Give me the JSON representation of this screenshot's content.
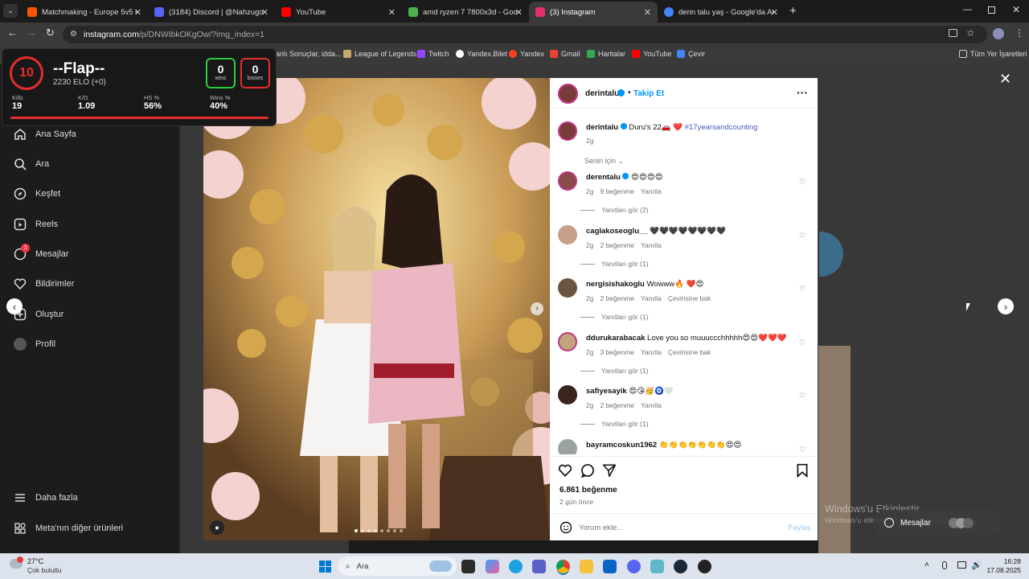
{
  "browser": {
    "tabs": [
      {
        "label": "Matchmaking - Europe 5v5 Qu",
        "color": "#ff5500"
      },
      {
        "label": "(3184) Discord | @Nahzugo",
        "color": "#5865f2"
      },
      {
        "label": "YouTube",
        "color": "#ff0000"
      },
      {
        "label": "amd ryzen 7 7800x3d - Google",
        "color": "#4caf50"
      },
      {
        "label": "(3) Instagram",
        "color": "#e1306c"
      },
      {
        "label": "derin talu yaş - Google'da Ara",
        "color": "#4285f4"
      }
    ],
    "url_host": "instagram.com",
    "url_path": "/p/DNWIbkOKgOw/?img_index=1",
    "bookmarks": [
      "anlı Sonuçlar, idda...",
      "League of Legends",
      "Twitch",
      "Yandex.Bilet",
      "Yandex",
      "Gmail",
      "Haritalar",
      "YouTube",
      "Çevir"
    ],
    "all_bookmarks": "Tüm Yer İşaretleri"
  },
  "faceit": {
    "level": "10",
    "name": "--Flap--",
    "elo": "2230 ELO (+0)",
    "wins_value": "0",
    "wins_label": "wins",
    "losses_value": "0",
    "losses_label": "losses",
    "stats": [
      {
        "label": "Kills",
        "value": "19"
      },
      {
        "label": "K/D",
        "value": "1.09"
      },
      {
        "label": "HS %",
        "value": "56%"
      },
      {
        "label": "Wins %",
        "value": "40%"
      }
    ]
  },
  "sidebar": {
    "items": [
      {
        "label": "Ana Sayfa",
        "icon": "home-icon"
      },
      {
        "label": "Ara",
        "icon": "search-icon"
      },
      {
        "label": "Keşfet",
        "icon": "compass-icon"
      },
      {
        "label": "Reels",
        "icon": "reels-icon"
      },
      {
        "label": "Mesajlar",
        "icon": "messenger-icon",
        "badge": "3"
      },
      {
        "label": "Bildirimler",
        "icon": "heart-icon"
      },
      {
        "label": "Oluştur",
        "icon": "plus-icon"
      },
      {
        "label": "Profil",
        "icon": "avatar-icon"
      }
    ],
    "more": "Daha fazla",
    "meta": "Meta'nın diğer ürünleri"
  },
  "post": {
    "author": "derintalu",
    "follow": "Takip Et",
    "caption_user": "derintalu",
    "caption_text": "Duru's 22🚗 ❤️",
    "caption_tag": "#17yearsandcounting",
    "caption_time": "2g",
    "sort_label": "Senin için",
    "comments": [
      {
        "user": "derentalu",
        "text": "😍😍😍😍",
        "time": "2g",
        "likes": "9 beğenme",
        "reply": "Yanıtla",
        "translate": "",
        "replies": "Yanıtları gör (2)"
      },
      {
        "user": "caglakoseoglu__",
        "text": "🖤🖤🖤🖤🖤🖤🖤🖤",
        "time": "2g",
        "likes": "2 beğenme",
        "reply": "Yanıtla",
        "translate": "",
        "replies": "Yanıtları gör (1)"
      },
      {
        "user": "nergisishakoglu",
        "text": "Wowww🔥 ❤️😍",
        "time": "2g",
        "likes": "2 beğenme",
        "reply": "Yanıtla",
        "translate": "Çevirisine bak",
        "replies": "Yanıtları gör (1)"
      },
      {
        "user": "ddurukarabacak",
        "text": "Love you so muuuccchhhhh😍😍❤️❤️❤️",
        "time": "2g",
        "likes": "3 beğenme",
        "reply": "Yanıtla",
        "translate": "Çevirisine bak",
        "replies": "Yanıtları gör (1)"
      },
      {
        "user": "safiyesayik",
        "text": "😍😘🥳🧿🤍",
        "time": "2g",
        "likes": "2 beğenme",
        "reply": "Yanıtla",
        "translate": "",
        "replies": "Yanıtları gör (1)"
      },
      {
        "user": "bayramcoskun1962",
        "text": "👏👏👏👏👏👏👏😍😍",
        "time": "",
        "likes": "",
        "reply": "",
        "translate": "",
        "replies": ""
      }
    ],
    "likes": "6.861 beğenme",
    "posted": "2 gün önce",
    "comment_placeholder": "Yorum ekle...",
    "share": "Paylaş"
  },
  "windows": {
    "activate_title": "Windows'u Etkinleştir",
    "activate_sub": "Windows'u etkinleştirmek için Ayarlara gidin.",
    "messages_label": "Mesajlar"
  },
  "taskbar": {
    "weather_temp": "27°C",
    "weather_desc": "Çok bulutlu",
    "search": "Ara",
    "time": "16:28",
    "date": "17.08.2025"
  }
}
